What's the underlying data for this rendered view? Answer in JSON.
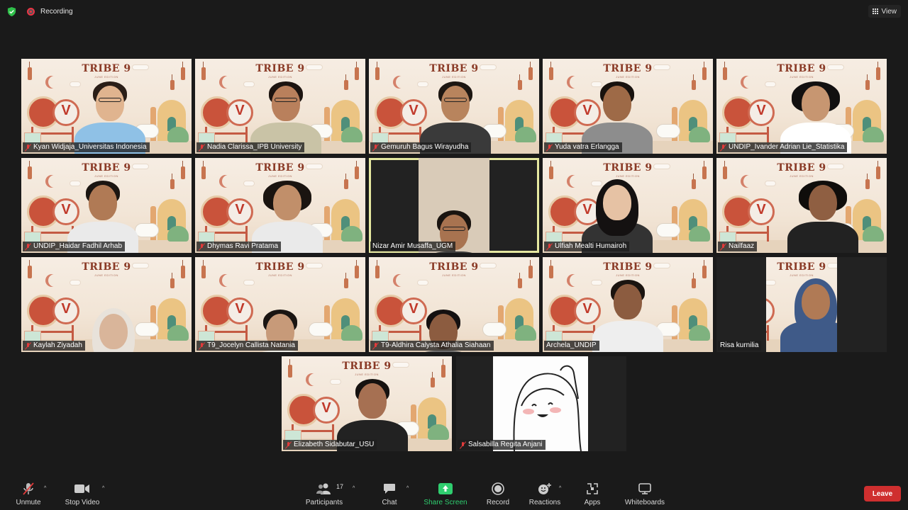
{
  "topbar": {
    "recording_label": "Recording",
    "view_label": "View",
    "shield_color": "#2fbf4a",
    "recording_color": "#e34444"
  },
  "grid_center_tiles": [
    "Nizar Amir Musaffa_UGM"
  ],
  "background": {
    "title": "TRIBE 9",
    "subtitle": "JUNE EDITION"
  },
  "participants": [
    {
      "name": "Kyan Widjaja_Universitas Indonesia",
      "muted": true
    },
    {
      "name": "Nadia Clarissa_IPB University",
      "muted": true
    },
    {
      "name": "Gemuruh Bagus Wirayudha",
      "muted": true
    },
    {
      "name": "Yuda vatra Erlangga",
      "muted": true
    },
    {
      "name": "UNDIP_Ivander Adrian Lie_Statistika",
      "muted": true
    },
    {
      "name": "UNDIP_Haidar Fadhil Arhab",
      "muted": true
    },
    {
      "name": "Dhymas Ravi Pratama",
      "muted": true
    },
    {
      "name": "Nizar Amir Musaffa_UGM",
      "muted": false,
      "speaking": true
    },
    {
      "name": "Ulfiah Mealti Humairoh",
      "muted": true
    },
    {
      "name": "Nailfaaz",
      "muted": true
    },
    {
      "name": "Kaylah Ziyadah",
      "muted": true
    },
    {
      "name": "T9_Jocelyn Callista Natania",
      "muted": true
    },
    {
      "name": "T9-Aldhira Calysta Athalia Siahaan",
      "muted": true
    },
    {
      "name": "Archela_UNDIP",
      "muted": false
    },
    {
      "name": "Risa kurnilia",
      "muted": false
    },
    {
      "name": "Elizabeth Sidabutar_USU",
      "muted": true
    },
    {
      "name": "Salsabilla Regita Anjani",
      "muted": true
    }
  ],
  "toolbar": {
    "unmute": "Unmute",
    "stop_video": "Stop Video",
    "participants": "Participants",
    "participants_count": "17",
    "chat": "Chat",
    "share_screen": "Share Screen",
    "record": "Record",
    "reactions": "Reactions",
    "apps": "Apps",
    "whiteboards": "Whiteboards",
    "leave": "Leave",
    "share_color": "#2fce6f",
    "leave_color": "#cf2f2f"
  }
}
